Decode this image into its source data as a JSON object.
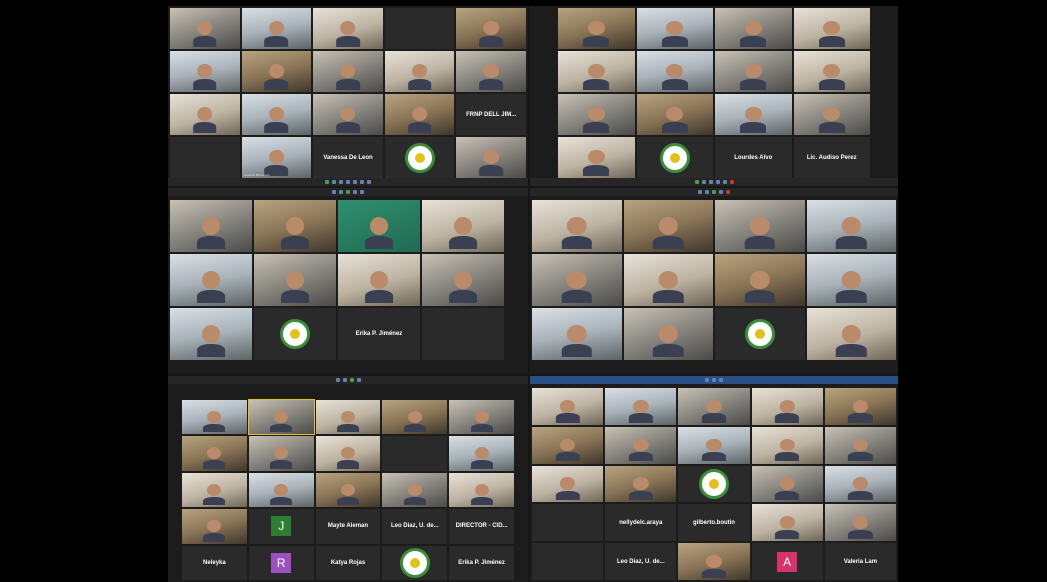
{
  "panels": {
    "p1": {
      "name_tiles": [
        "Vanessa De Leon",
        "FRNP DELL JIM..."
      ],
      "captions": [
        "Analucia Barraneco"
      ]
    },
    "p2": {
      "name_tiles": [
        "Lourdes Alvo",
        "Lic. Audiso Perez"
      ]
    },
    "p3": {
      "name_tiles": [
        "Erika P. Jiménez"
      ]
    },
    "p5": {
      "name_tiles": [
        "Mayte Aleman",
        "Leo Diaz, U. de...",
        "DIRECTOR - CID..."
      ],
      "bottom_names": [
        "Neleyka",
        "Katya Rojas",
        "Erika P. Jiménez"
      ],
      "avatars": [
        {
          "letter": "J",
          "color": "#2e7d32"
        },
        {
          "letter": "R",
          "color": "#9c4fbf"
        }
      ]
    },
    "p6": {
      "name_tiles": [
        "nellydelc.araya",
        "gilberto.boutin"
      ],
      "bottom_names": [
        "Leo Diaz, U. de...",
        "Valeria Lam"
      ],
      "avatars": [
        {
          "letter": "A",
          "color": "#d6336c"
        }
      ]
    }
  }
}
